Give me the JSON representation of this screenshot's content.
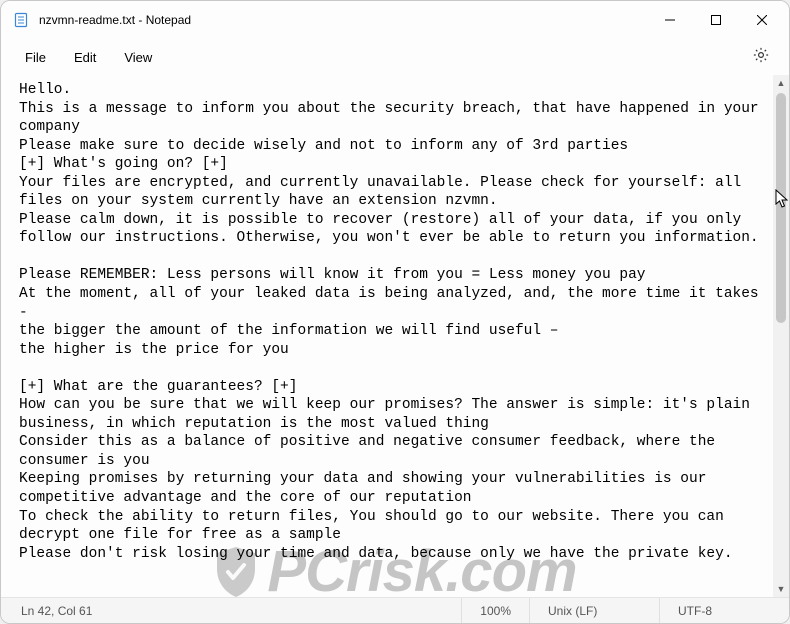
{
  "window": {
    "title": "nzvmn-readme.txt - Notepad"
  },
  "menubar": {
    "file": "File",
    "edit": "Edit",
    "view": "View"
  },
  "editor": {
    "content": "Hello.\nThis is a message to inform you about the security breach, that have happened in your company\nPlease make sure to decide wisely and not to inform any of 3rd parties\n[+] What's going on? [+]\nYour files are encrypted, and currently unavailable. Please check for yourself: all files on your system currently have an extension nzvmn.\nPlease calm down, it is possible to recover (restore) all of your data, if you only follow our instructions. Otherwise, you won't ever be able to return you information.\n\nPlease REMEMBER: Less persons will know it from you = Less money you pay\nAt the moment, all of your leaked data is being analyzed, and, the more time it takes -\nthe bigger the amount of the information we will find useful –\nthe higher is the price for you\n\n[+] What are the guarantees? [+]\nHow can you be sure that we will keep our promises? The answer is simple: it's plain business, in which reputation is the most valued thing\nConsider this as a balance of positive and negative consumer feedback, where the consumer is you\nKeeping promises by returning your data and showing your vulnerabilities is our competitive advantage and the core of our reputation\nTo check the ability to return files, You should go to our website. There you can decrypt one file for free as a sample\nPlease don't risk losing your time and data, because only we have the private key."
  },
  "statusbar": {
    "position": "Ln 42, Col 61",
    "zoom": "100%",
    "line_ending": "Unix (LF)",
    "encoding": "UTF-8"
  },
  "watermark": {
    "text": "PCrisk.com"
  }
}
